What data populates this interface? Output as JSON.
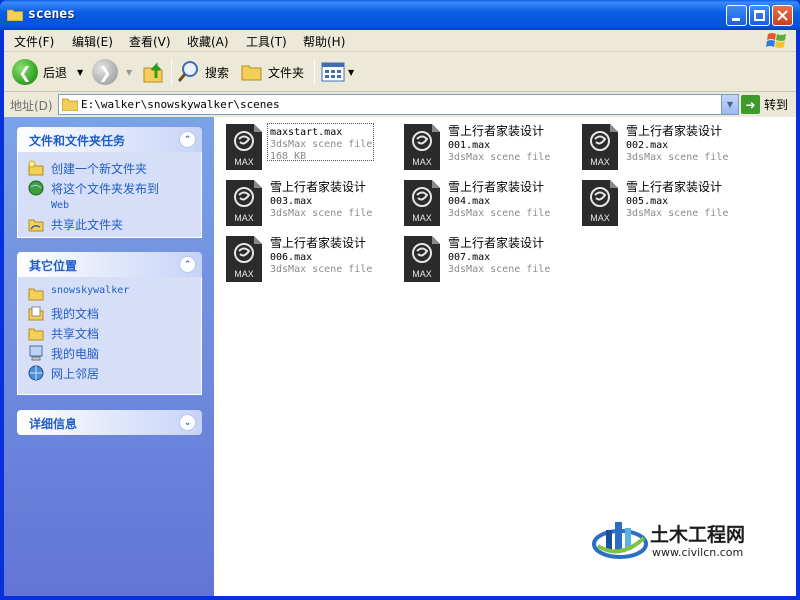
{
  "window": {
    "title": "scenes"
  },
  "menu": [
    "文件(F)",
    "编辑(E)",
    "查看(V)",
    "收藏(A)",
    "工具(T)",
    "帮助(H)"
  ],
  "toolbar": {
    "back": "后退",
    "search": "搜索",
    "folders": "文件夹"
  },
  "address": {
    "label": "地址(D)",
    "path": "E:\\walker\\snowskywalker\\scenes",
    "go": "转到"
  },
  "tasks_panel": {
    "title": "文件和文件夹任务",
    "items": [
      {
        "label": "创建一个新文件夹",
        "icon": "new-folder-icon"
      },
      {
        "label": "将这个文件夹发布到",
        "label2": "Web",
        "icon": "publish-web-icon"
      },
      {
        "label": "共享此文件夹",
        "icon": "share-folder-icon"
      }
    ]
  },
  "places_panel": {
    "title": "其它位置",
    "items": [
      {
        "label": "snowskywalker",
        "icon": "folder-icon"
      },
      {
        "label": "我的文档",
        "icon": "my-documents-icon"
      },
      {
        "label": "共享文档",
        "icon": "shared-documents-icon"
      },
      {
        "label": "我的电脑",
        "icon": "my-computer-icon"
      },
      {
        "label": "网上邻居",
        "icon": "network-places-icon"
      }
    ]
  },
  "details_panel": {
    "title": "详细信息"
  },
  "files": [
    {
      "line1": "maxstart.max",
      "line2": "",
      "type": "3dsMax scene file",
      "size": "168 KB"
    },
    {
      "line1": "雪上行者家装设计",
      "line2": "001.max",
      "type": "3dsMax scene file",
      "size": ""
    },
    {
      "line1": "雪上行者家装设计",
      "line2": "002.max",
      "type": "3dsMax scene file",
      "size": ""
    },
    {
      "line1": "雪上行者家装设计",
      "line2": "003.max",
      "type": "3dsMax scene file",
      "size": ""
    },
    {
      "line1": "雪上行者家装设计",
      "line2": "004.max",
      "type": "3dsMax scene file",
      "size": ""
    },
    {
      "line1": "雪上行者家装设计",
      "line2": "005.max",
      "type": "3dsMax scene file",
      "size": ""
    },
    {
      "line1": "雪上行者家装设计",
      "line2": "006.max",
      "type": "3dsMax scene file",
      "size": ""
    },
    {
      "line1": "雪上行者家装设计",
      "line2": "007.max",
      "type": "3dsMax scene file",
      "size": ""
    }
  ],
  "file_icon_label": "MAX",
  "watermark": {
    "name": "土木工程网",
    "url": "www.civilcn.com"
  },
  "colors": {
    "titlebar": "#0a5fe5",
    "taskpane": "#6375d6",
    "link": "#215dc6",
    "chrome": "#ece9d8"
  }
}
